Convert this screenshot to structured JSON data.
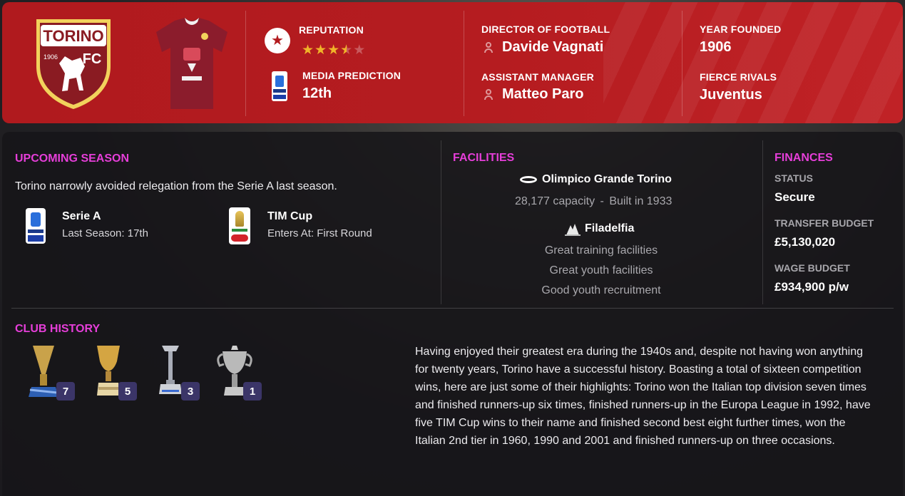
{
  "header": {
    "club_crest_text": "TORINO",
    "club_crest_year": "1906",
    "club_crest_fc": "FC",
    "reputation_label": "REPUTATION",
    "reputation_stars": 3.5,
    "reputation_max": 5,
    "media_prediction_label": "MEDIA PREDICTION",
    "media_prediction_value": "12th",
    "director_label": "DIRECTOR OF FOOTBALL",
    "director_value": "Davide Vagnati",
    "assistant_label": "ASSISTANT MANAGER",
    "assistant_value": "Matteo Paro",
    "founded_label": "YEAR FOUNDED",
    "founded_value": "1906",
    "rivals_label": "FIERCE RIVALS",
    "rivals_value": "Juventus"
  },
  "upcoming": {
    "title": "UPCOMING SEASON",
    "summary": "Torino narrowly avoided relegation from the Serie A last season.",
    "competitions": [
      {
        "name": "Serie A",
        "detail": "Last Season: 17th"
      },
      {
        "name": "TIM Cup",
        "detail": "Enters At: First Round"
      }
    ]
  },
  "facilities": {
    "title": "FACILITIES",
    "stadium_name": "Olimpico Grande Torino",
    "stadium_capacity": "28,177 capacity",
    "stadium_sep": "-",
    "stadium_built": "Built in 1933",
    "training_name": "Filadelfia",
    "training_items": [
      "Great training facilities",
      "Great youth facilities",
      "Good youth recruitment"
    ]
  },
  "finances": {
    "title": "FINANCES",
    "status_label": "STATUS",
    "status_value": "Secure",
    "transfer_label": "TRANSFER BUDGET",
    "transfer_value": "£5,130,020",
    "wage_label": "WAGE BUDGET",
    "wage_value": "£934,900 p/w"
  },
  "history": {
    "title": "CLUB HISTORY",
    "trophies": [
      {
        "icon": "league-trophy-icon",
        "count": "7"
      },
      {
        "icon": "cup-trophy-icon",
        "count": "5"
      },
      {
        "icon": "second-tier-trophy-icon",
        "count": "3"
      },
      {
        "icon": "historic-cup-trophy-icon",
        "count": "1"
      }
    ],
    "text": "Having enjoyed their greatest era during the 1940s and, despite not having won anything for twenty years, Torino have a successful history. Boasting a total of sixteen competition wins, here are just some of their highlights: Torino won the Italian top division seven times and finished runners-up six times, finished runners-up in the Europa League in 1992, have five TIM Cup wins to their name and finished second best eight further times, won the Italian 2nd tier in 1960, 1990 and 2001 and finished runners-up on three occasions."
  },
  "colors": {
    "header_red": "#b51c20",
    "section_accent": "#e63ed9",
    "star_gold": "#f0b429",
    "badge_bg": "#3b3568"
  }
}
